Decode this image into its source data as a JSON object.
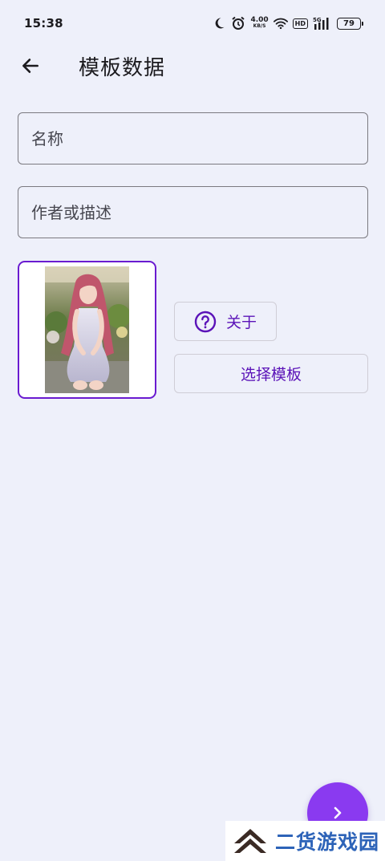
{
  "status_bar": {
    "time": "15:38",
    "net_speed_value": "4.00",
    "net_speed_unit": "KB/S",
    "hd_badge": "HD",
    "signal_label": "5G",
    "battery_level": "79",
    "icons": [
      "moon-icon",
      "alarm-icon",
      "wifi-icon",
      "signal-icon",
      "battery-icon"
    ]
  },
  "header": {
    "title": "模板数据",
    "back_icon": "arrow-left-icon"
  },
  "form": {
    "name_placeholder": "名称",
    "name_value": "",
    "desc_placeholder": "作者或描述",
    "desc_value": ""
  },
  "template": {
    "about_label": "关于",
    "choose_label": "选择模板",
    "about_icon": "help-circle-icon"
  },
  "fab": {
    "icon": "chevron-right-icon"
  },
  "watermark": {
    "text": "二货游戏园"
  },
  "colors": {
    "background": "#eef0fa",
    "accent": "#6a1bd0",
    "fab": "#8a3af0",
    "button_text": "#5b13b8"
  }
}
